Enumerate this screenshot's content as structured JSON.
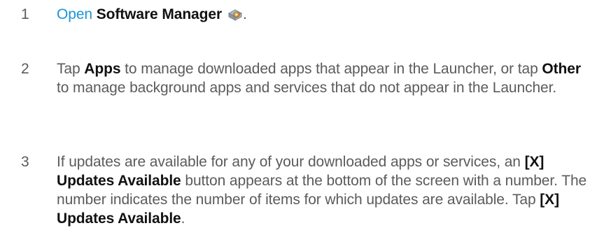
{
  "steps": [
    {
      "number": "1",
      "open": "Open",
      "app_name": "Software Manager",
      "icon": "software-manager-icon",
      "period": "."
    },
    {
      "number": "2",
      "text_1": "Tap ",
      "bold_1": "Apps",
      "text_2": " to manage downloaded apps that appear in the Launcher, or tap ",
      "bold_2": "Other",
      "text_3": " to manage background apps and services that do not appear in the Launcher."
    },
    {
      "number": "3",
      "text_1": "If updates are available for any of your downloaded apps or services, an ",
      "bold_1": "[X] Updates Available",
      "text_2": " button appears at the bottom of the screen with a number. The number indicates the number of items for which updates are available. Tap ",
      "bold_2": "[X] Updates Available",
      "text_3": "."
    }
  ],
  "colors": {
    "link": "#1a96d4",
    "body_text": "#5b5b5b",
    "bold_text": "#111111"
  }
}
